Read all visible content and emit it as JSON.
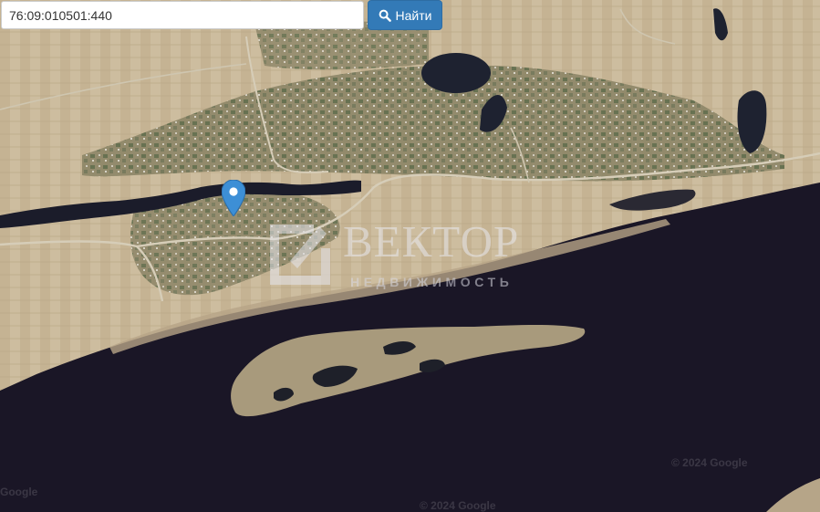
{
  "search": {
    "value": "76:09:010501:440",
    "button_label": "Найти",
    "button_icon": "search-icon"
  },
  "map": {
    "marker_icon": "map-pin-icon",
    "marker_color": "#3d8fd6",
    "water_color": "#1a1626",
    "land_color": "#c8b79a"
  },
  "watermark": {
    "brand": "ВЕКТОР",
    "tagline": "НЕДВИЖИМОСТЬ"
  },
  "attribution": {
    "right": "© 2024 Google",
    "bottom": "© 2024 Google",
    "left": "Google"
  }
}
